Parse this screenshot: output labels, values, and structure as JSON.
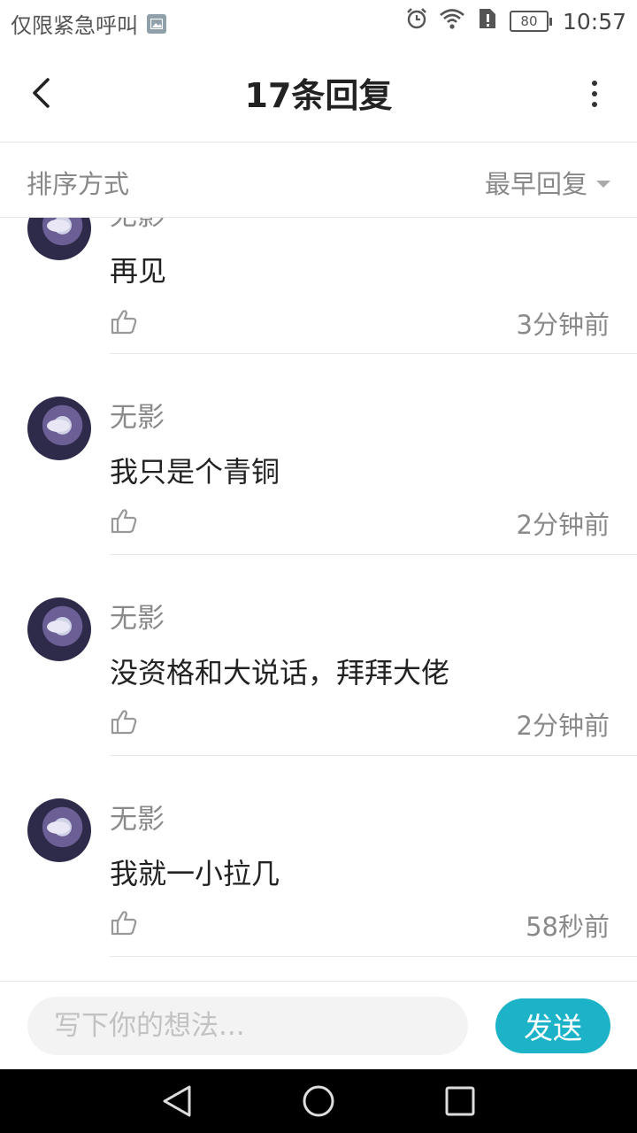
{
  "status_bar": {
    "carrier_text": "仅限紧急呼叫",
    "battery_level": "80",
    "time": "10:57"
  },
  "header": {
    "title": "17条回复"
  },
  "sort": {
    "label": "排序方式",
    "selected": "最早回复"
  },
  "comments": [
    {
      "username": "无影",
      "text": "再见",
      "time": "3分钟前"
    },
    {
      "username": "无影",
      "text": "我只是个青铜",
      "time": "2分钟前"
    },
    {
      "username": "无影",
      "text": "没资格和大说话，拜拜大佬",
      "time": "2分钟前"
    },
    {
      "username": "无影",
      "text": "我就一小拉几",
      "time": "58秒前"
    }
  ],
  "composer": {
    "placeholder": "写下你的想法...",
    "send_label": "发送"
  },
  "colors": {
    "accent": "#1cb3c8",
    "secondary_text": "#8a8a8a"
  }
}
